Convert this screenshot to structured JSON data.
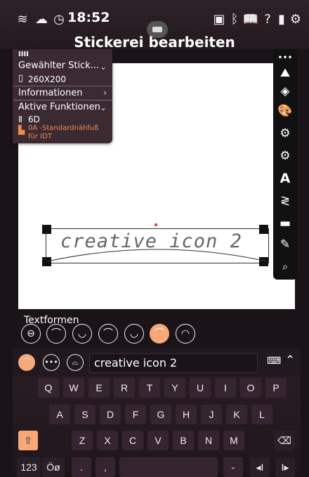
{
  "status_bar": {
    "time": "18:52",
    "icons": [
      "wifi-icon",
      "cloud-off-icon",
      "clock-icon",
      "machine-icon",
      "cast-icon",
      "bluetooth-icon",
      "book-icon",
      "help-icon",
      "tablet-icon",
      "settings-icon"
    ]
  },
  "header": {
    "title": "Stickerei bearbeiten"
  },
  "panel": {
    "handle_glyph": "IIII",
    "selected_stitch": "Gewählter Stick...",
    "hoop_size": "260X200",
    "informationen": "Informationen",
    "active_functions": "Aktive Funktionen",
    "needle": "6D",
    "presser_foot": "0A -Standardnähfuß für IDT"
  },
  "canvas": {
    "embroidery_text": "creative icon 2"
  },
  "text_shapes": {
    "label": "Textformen"
  },
  "input": {
    "value": "creative icon 2"
  },
  "keyboard": {
    "row1": [
      "Q",
      "W",
      "E",
      "R",
      "T",
      "Y",
      "U",
      "I",
      "O",
      "P"
    ],
    "row2": [
      "A",
      "S",
      "D",
      "F",
      "G",
      "H",
      "J",
      "K",
      "L"
    ],
    "row3": [
      "Z",
      "X",
      "C",
      "V",
      "B",
      "N",
      "M"
    ],
    "numbers_label": "123",
    "special_label": "Öø",
    "period": ".",
    "comma": ","
  },
  "colors": {
    "accent": "#f6a878",
    "orange_text": "#f08a4b",
    "panel_bg": "#3c2a33"
  }
}
